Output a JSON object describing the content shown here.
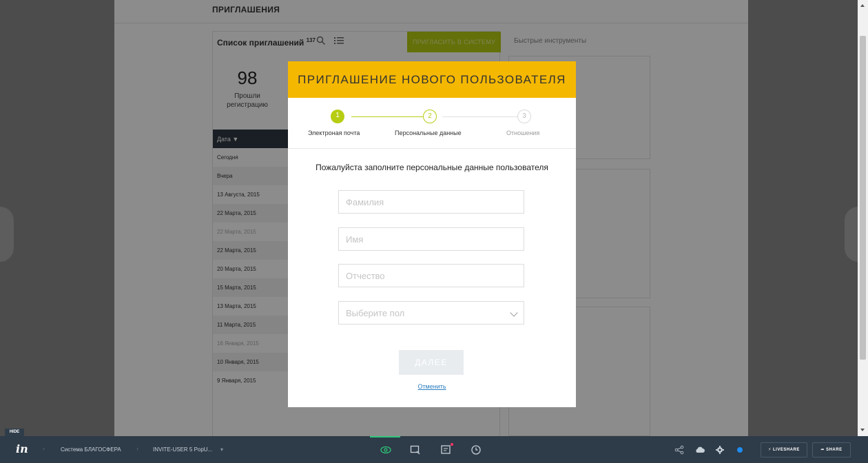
{
  "header": {
    "title": "ПРИГЛАШЕНИЯ"
  },
  "invites_list": {
    "title": "Список приглашений",
    "count": "137",
    "invite_button": "ПРИГЛАСИТЬ В СИСТЕМУ",
    "quick_tools_tab": "Быстрые инструменты"
  },
  "stat": {
    "value": "98",
    "caption_line1": "Прошли",
    "caption_line2": "регистрацию"
  },
  "table": {
    "column_header": "Дата ▼",
    "rows": [
      "Сегодня",
      "Вчера",
      "13 Августа, 2015",
      "22 Марта, 2015",
      "22 Марта, 2015",
      "22 Марта, 2015",
      "20 Марта, 2015",
      "15 Марта, 2015",
      "13 Марта, 2015",
      "11 Марта, 2015",
      "16 Января, 2015",
      "10 Января, 2015",
      "9 Января, 2015"
    ]
  },
  "modal": {
    "title": "ПРИГЛАШЕНИЕ НОВОГО ПОЛЬЗОВАТЕЛЯ",
    "steps": [
      {
        "number": "1",
        "label": "Электронaя почта",
        "state": "done"
      },
      {
        "number": "2",
        "label": "Персональные данные",
        "state": "active"
      },
      {
        "number": "3",
        "label": "Отношения",
        "state": "pending"
      }
    ],
    "prompt": "Пожалуйста заполните персональные данные пользователя",
    "fields": {
      "last_name_placeholder": "Фамилия",
      "first_name_placeholder": "Имя",
      "middle_name_placeholder": "Отчество",
      "gender_placeholder": "Выберите пол"
    },
    "next_button": "ДАЛЕЕ",
    "cancel_link": "Отменить"
  },
  "invision": {
    "hide_label": "HIDE",
    "logo": "in",
    "breadcrumb_project": "Система БЛАГОСФЕРА",
    "breadcrumb_screen": "INVITE-USER 5 PopU...",
    "liveshare_label": "LIVESHARE",
    "share_label": "SHARE"
  },
  "colors": {
    "modal_header": "#f5b800",
    "accent_green": "#b7cd12",
    "toolbar_bg": "#2e3b48",
    "link_blue": "#2b7ec1"
  }
}
